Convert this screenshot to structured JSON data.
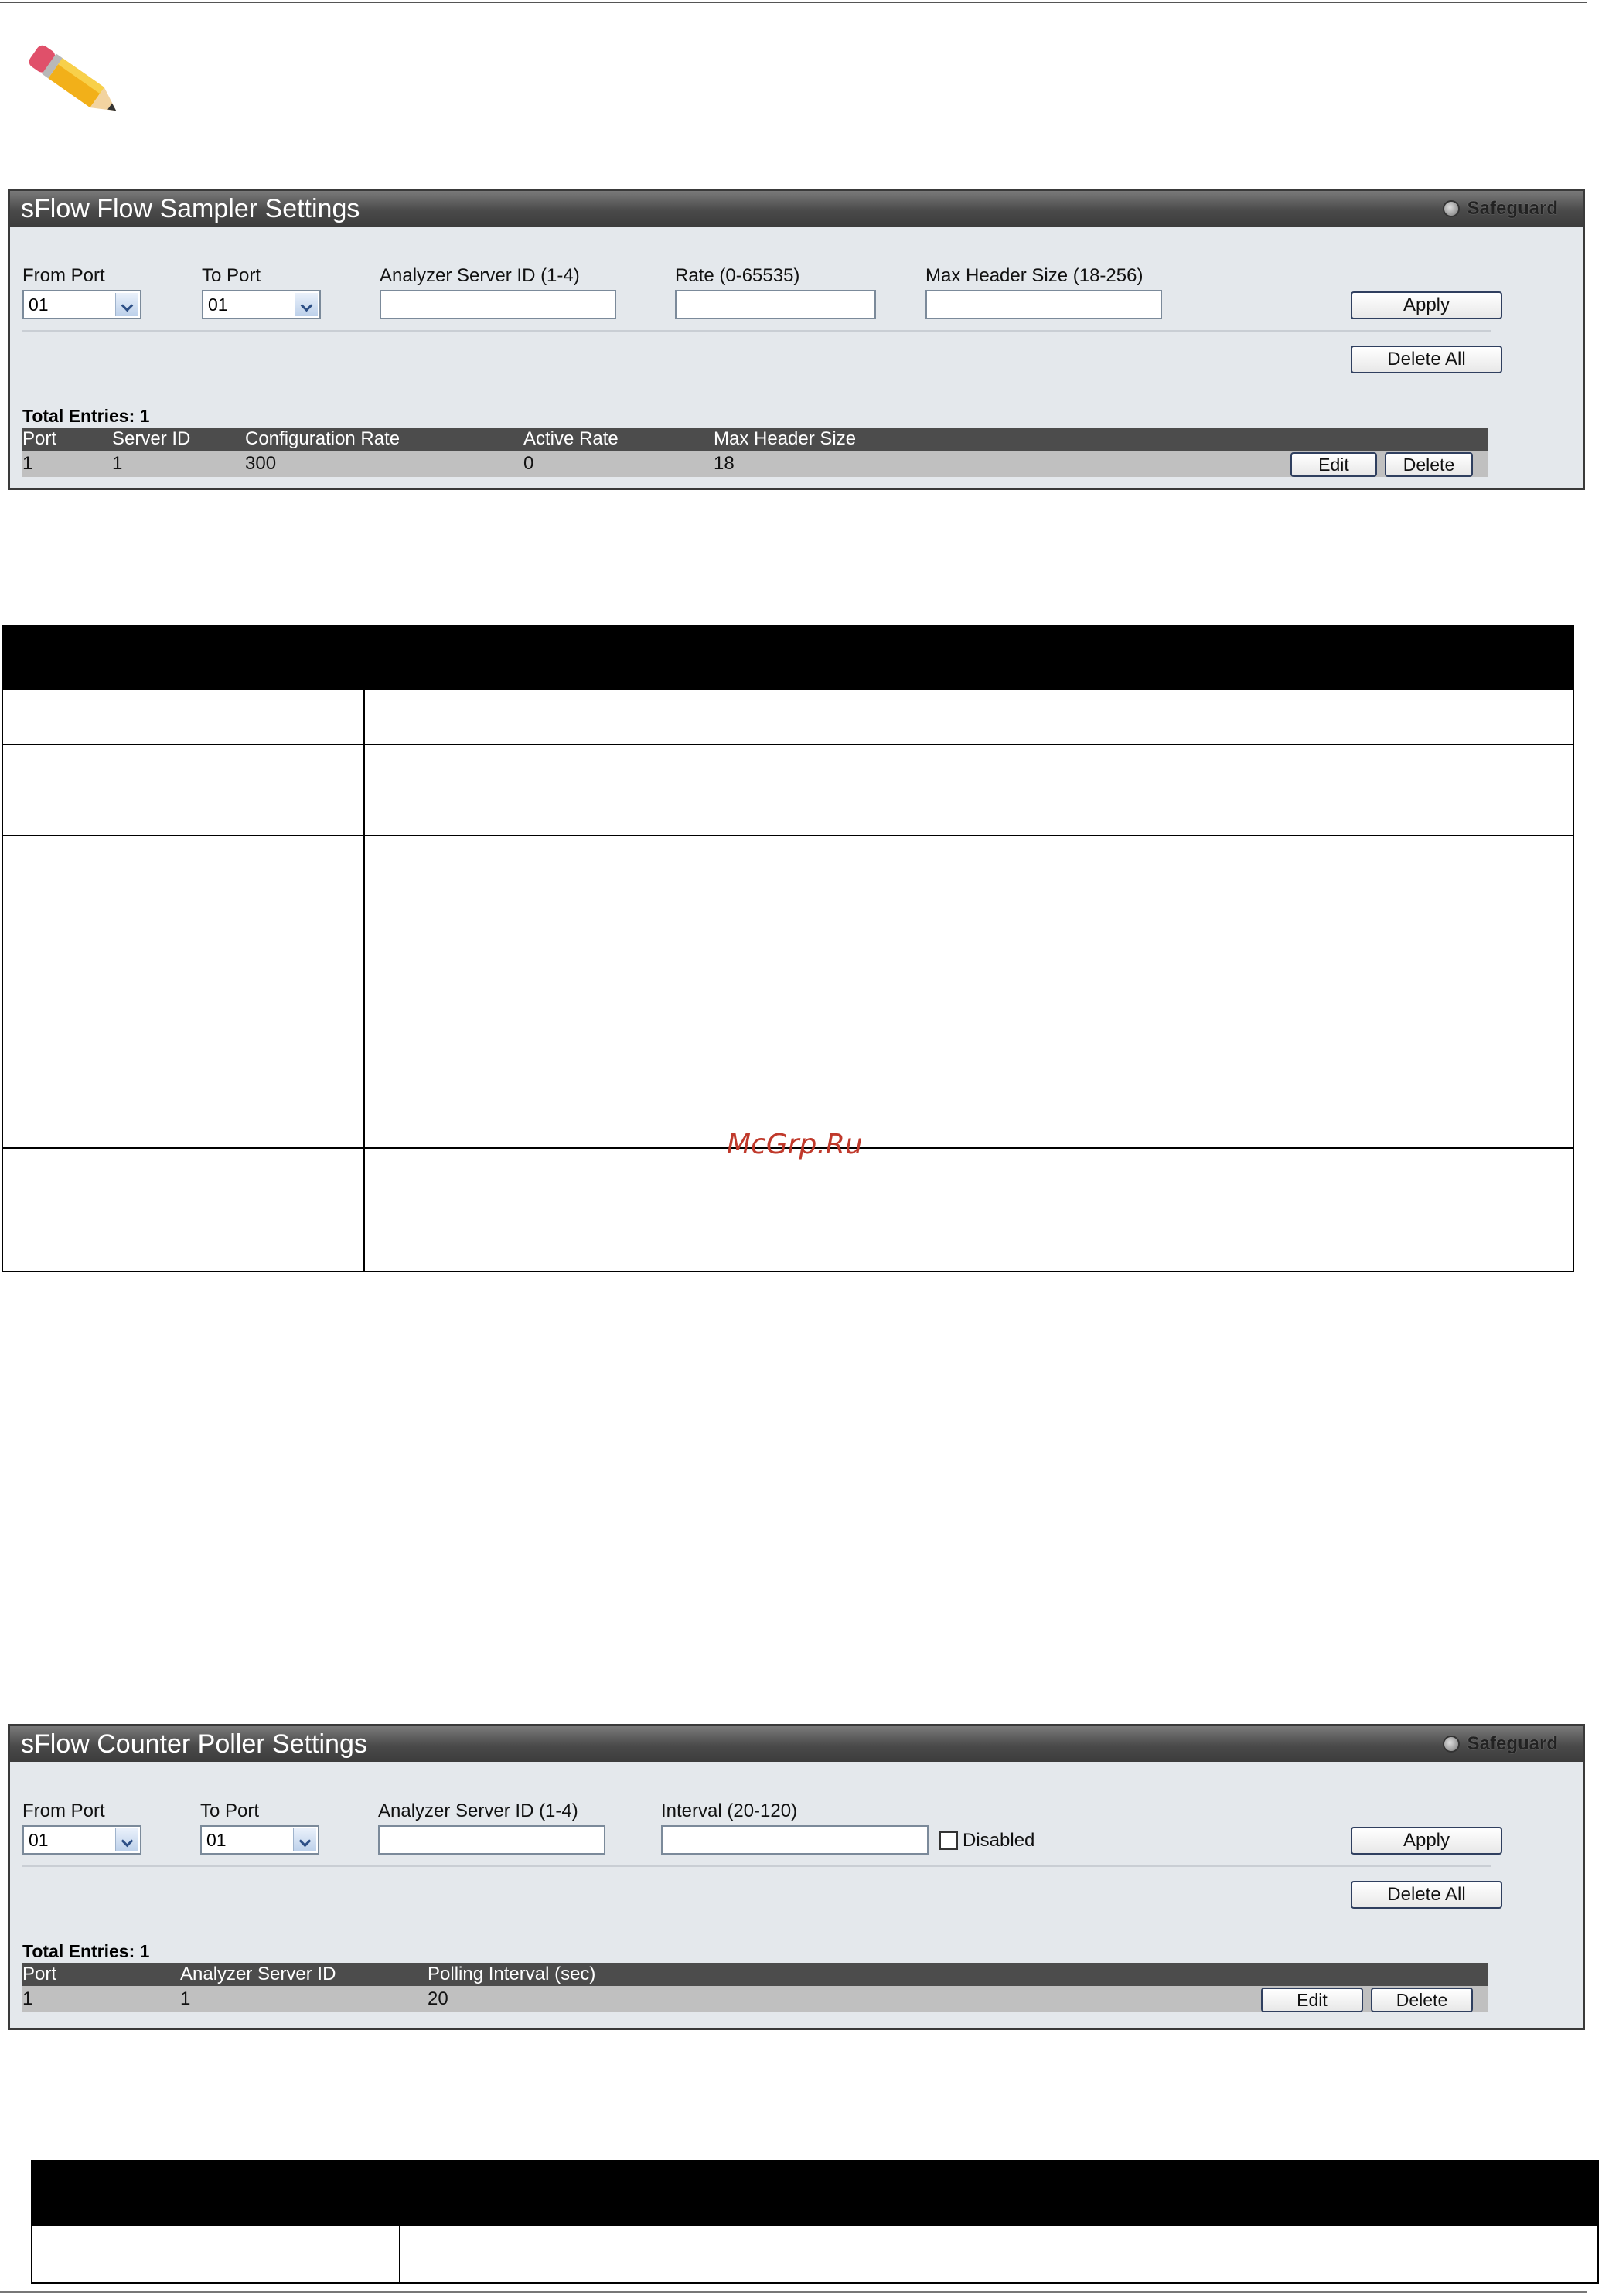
{
  "sampler": {
    "title": "sFlow Flow Sampler Settings",
    "safeguard": "Safeguard",
    "labels": {
      "from_port": "From Port",
      "to_port": "To Port",
      "analyzer_server_id": "Analyzer Server ID (1-4)",
      "rate": "Rate (0-65535)",
      "max_header_size": "Max Header Size (18-256)"
    },
    "from_port_value": "01",
    "to_port_value": "01",
    "apply_label": "Apply",
    "delete_all_label": "Delete All",
    "total_entries": "Total Entries: 1",
    "columns": [
      "Port",
      "Server ID",
      "Configuration Rate",
      "Active Rate",
      "Max Header Size"
    ],
    "rows": [
      [
        "1",
        "1",
        "300",
        "0",
        "18"
      ]
    ],
    "edit_label": "Edit",
    "delete_label": "Delete"
  },
  "poller": {
    "title": "sFlow Counter Poller Settings",
    "safeguard": "Safeguard",
    "labels": {
      "from_port": "From Port",
      "to_port": "To Port",
      "analyzer_server_id": "Analyzer Server ID (1-4)",
      "interval": "Interval (20-120)",
      "disabled": "Disabled"
    },
    "from_port_value": "01",
    "to_port_value": "01",
    "apply_label": "Apply",
    "delete_all_label": "Delete All",
    "total_entries": "Total Entries: 1",
    "columns": [
      "Port",
      "Analyzer Server ID",
      "Polling Interval (sec)"
    ],
    "rows": [
      [
        "1",
        "1",
        "20"
      ]
    ],
    "edit_label": "Edit",
    "delete_label": "Delete"
  },
  "watermark": "McGrp.Ru",
  "icons": {
    "note": "pencil-icon",
    "status": "safeguard-indicator-icon",
    "dropdown": "chevron-down-icon"
  }
}
